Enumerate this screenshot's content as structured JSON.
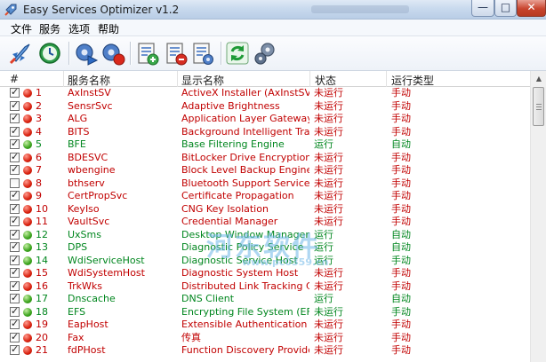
{
  "window": {
    "title": "Easy Services Optimizer v1.2",
    "icon": "rocket-icon",
    "controls": {
      "minimize": "—",
      "maximize": "□",
      "close": "✕"
    }
  },
  "menu": [
    "文件",
    "服务",
    "选项",
    "帮助"
  ],
  "toolbar": [
    {
      "name": "optimize-rocket-icon"
    },
    {
      "name": "clock-restore-icon"
    },
    {
      "name": "gear-forward-icon"
    },
    {
      "name": "gear-stop-icon"
    },
    {
      "name": "list-add-icon"
    },
    {
      "name": "list-remove-icon"
    },
    {
      "name": "list-edit-icon"
    },
    {
      "name": "refresh-icon"
    },
    {
      "name": "settings-gears-icon"
    }
  ],
  "columns": {
    "num": "#",
    "service_name": "服务名称",
    "display_name": "显示名称",
    "status": "状态",
    "start_type": "运行类型"
  },
  "colors": {
    "stopped": "#c10000",
    "running": "#00861e"
  },
  "rows": [
    {
      "checked": true,
      "running": false,
      "num": "1",
      "name": "AxInstSV",
      "display": "ActiveX Installer (AxInstSV)",
      "status": "未运行",
      "type": "手动"
    },
    {
      "checked": true,
      "running": false,
      "num": "2",
      "name": "SensrSvc",
      "display": "Adaptive Brightness",
      "status": "未运行",
      "type": "手动"
    },
    {
      "checked": true,
      "running": false,
      "num": "3",
      "name": "ALG",
      "display": "Application Layer Gateway Ser...",
      "status": "未运行",
      "type": "手动"
    },
    {
      "checked": true,
      "running": false,
      "num": "4",
      "name": "BITS",
      "display": "Background Intelligent Transfer...",
      "status": "未运行",
      "type": "手动"
    },
    {
      "checked": true,
      "running": true,
      "num": "5",
      "name": "BFE",
      "display": "Base Filtering Engine",
      "status": "运行",
      "type": "自动"
    },
    {
      "checked": true,
      "running": false,
      "num": "6",
      "name": "BDESVC",
      "display": "BitLocker Drive Encryption Service",
      "status": "未运行",
      "type": "手动"
    },
    {
      "checked": true,
      "running": false,
      "num": "7",
      "name": "wbengine",
      "display": "Block Level Backup Engine Service",
      "status": "未运行",
      "type": "手动"
    },
    {
      "checked": false,
      "running": false,
      "num": "8",
      "name": "bthserv",
      "display": "Bluetooth Support Service",
      "status": "未运行",
      "type": "手动"
    },
    {
      "checked": true,
      "running": false,
      "num": "9",
      "name": "CertPropSvc",
      "display": "Certificate Propagation",
      "status": "未运行",
      "type": "手动"
    },
    {
      "checked": true,
      "running": false,
      "num": "10",
      "name": "KeyIso",
      "display": "CNG Key Isolation",
      "status": "未运行",
      "type": "手动"
    },
    {
      "checked": true,
      "running": false,
      "num": "11",
      "name": "VaultSvc",
      "display": "Credential Manager",
      "status": "未运行",
      "type": "手动"
    },
    {
      "checked": true,
      "running": true,
      "num": "12",
      "name": "UxSms",
      "display": "Desktop Window Manager Sess...",
      "status": "运行",
      "type": "自动"
    },
    {
      "checked": true,
      "running": true,
      "num": "13",
      "name": "DPS",
      "display": "Diagnostic Policy Service",
      "status": "运行",
      "type": "自动"
    },
    {
      "checked": true,
      "running": true,
      "num": "14",
      "name": "WdiServiceHost",
      "display": "Diagnostic Service Host",
      "status": "运行",
      "type": "手动"
    },
    {
      "checked": true,
      "running": false,
      "num": "15",
      "name": "WdiSystemHost",
      "display": "Diagnostic System Host",
      "status": "未运行",
      "type": "手动"
    },
    {
      "checked": true,
      "running": false,
      "num": "16",
      "name": "TrkWks",
      "display": "Distributed Link Tracking Client",
      "status": "未运行",
      "type": "手动"
    },
    {
      "checked": true,
      "running": true,
      "num": "17",
      "name": "Dnscache",
      "display": "DNS Client",
      "status": "运行",
      "type": "自动"
    },
    {
      "checked": true,
      "running": true,
      "num": "18",
      "name": "EFS",
      "display": "Encrypting File System (EFS)",
      "status": "未运行",
      "type": "手动"
    },
    {
      "checked": true,
      "running": false,
      "num": "19",
      "name": "EapHost",
      "display": "Extensible Authentication Proto...",
      "status": "未运行",
      "type": "手动"
    },
    {
      "checked": true,
      "running": false,
      "num": "20",
      "name": "Fax",
      "display": "传真",
      "status": "未运行",
      "type": "手动"
    },
    {
      "checked": true,
      "running": false,
      "num": "21",
      "name": "fdPHost",
      "display": "Function Discovery Provider Host",
      "status": "未运行",
      "type": "手动"
    }
  ]
}
